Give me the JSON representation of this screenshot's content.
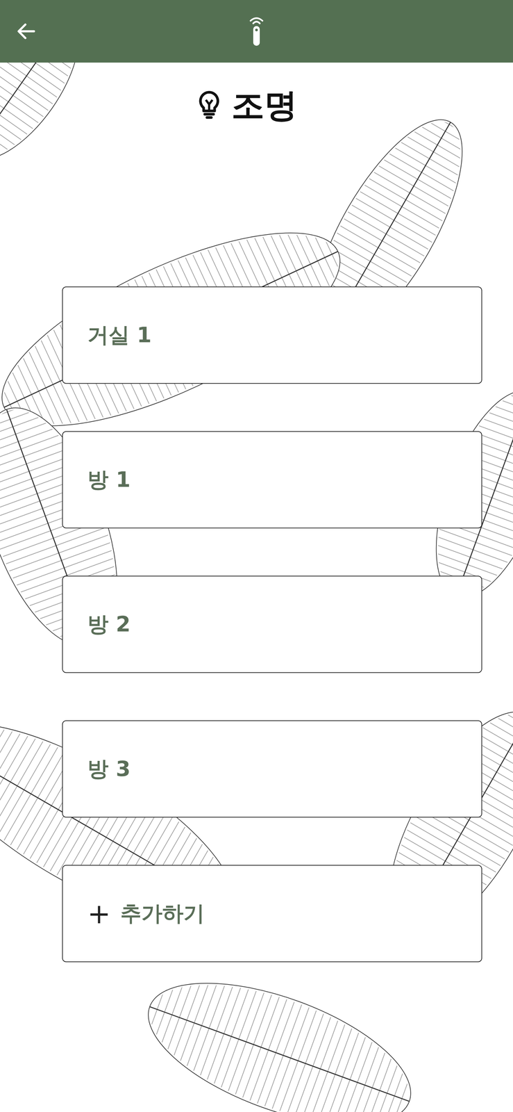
{
  "header": {
    "title": "조명"
  },
  "rooms": [
    {
      "label": "거실 1"
    },
    {
      "label": "방 1"
    },
    {
      "label": "방 2"
    },
    {
      "label": "방 3"
    }
  ],
  "add_button": {
    "icon": "+",
    "label": "추가하기"
  }
}
